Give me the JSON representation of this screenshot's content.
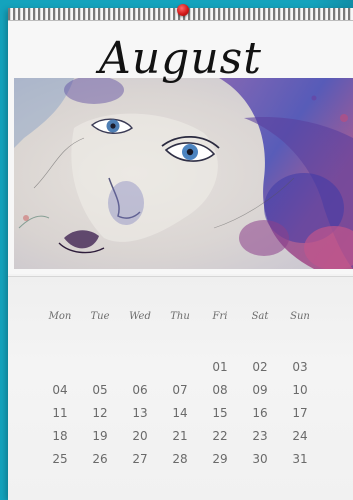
{
  "calendar": {
    "month": "August",
    "weekdays": [
      "Mon",
      "Tue",
      "Wed",
      "Thu",
      "Fri",
      "Sat",
      "Sun"
    ],
    "weeks": [
      [
        "",
        "",
        "",
        "",
        "01",
        "02",
        "03"
      ],
      [
        "04",
        "05",
        "06",
        "07",
        "08",
        "09",
        "10"
      ],
      [
        "11",
        "12",
        "13",
        "14",
        "15",
        "16",
        "17"
      ],
      [
        "18",
        "19",
        "20",
        "21",
        "22",
        "23",
        "24"
      ],
      [
        "25",
        "26",
        "27",
        "28",
        "29",
        "30",
        "31"
      ]
    ],
    "artwork_icon": "watercolor-woman-portrait-icon"
  },
  "colors": {
    "background": "#14a3bd",
    "paper": "#f3f3f3",
    "hook": "#d41a1a",
    "title": "#121212",
    "day_text": "#6a6a6a"
  }
}
